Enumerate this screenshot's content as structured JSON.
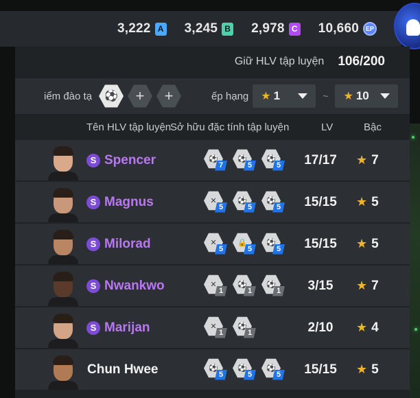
{
  "currency": [
    {
      "value": "3,222",
      "badge": "A",
      "color": "#4aa8ff"
    },
    {
      "value": "3,245",
      "badge": "B",
      "color": "#4fd0a8"
    },
    {
      "value": "2,978",
      "badge": "C",
      "color": "#b24cf0"
    },
    {
      "value": "10,660",
      "badge": "EP",
      "color": "#5b86ff"
    }
  ],
  "hold": {
    "label": "Giữ HLV tập luyện",
    "value": "106/200"
  },
  "filter": {
    "points_label": "iểm đào tạ",
    "rank_label": "ếp hạng",
    "rank_from": "1",
    "rank_to": "10",
    "tilde": "~"
  },
  "headers": {
    "name": "Tên HLV tập luyện",
    "traits": "Sở hữu đặc tính tập luyện",
    "lv": "LV",
    "rank": "Bậc"
  },
  "coaches": [
    {
      "name": "Spencer",
      "special": true,
      "lv": "17/17",
      "rank": "7",
      "traits": [
        {
          "level": "7",
          "color": "blue"
        },
        {
          "level": "5",
          "color": "blue"
        },
        {
          "level": "5",
          "color": "blue"
        }
      ]
    },
    {
      "name": "Magnus",
      "special": true,
      "lv": "15/15",
      "rank": "5",
      "traits": [
        {
          "level": "5",
          "color": "blue"
        },
        {
          "level": "5",
          "color": "blue"
        },
        {
          "level": "5",
          "color": "blue"
        }
      ]
    },
    {
      "name": "Milorad",
      "special": true,
      "lv": "15/15",
      "rank": "5",
      "traits": [
        {
          "level": "5",
          "color": "blue"
        },
        {
          "level": "5",
          "color": "blue"
        },
        {
          "level": "5",
          "color": "blue"
        }
      ]
    },
    {
      "name": "Nwankwo",
      "special": true,
      "lv": "3/15",
      "rank": "7",
      "traits": [
        {
          "level": "1",
          "color": "grey"
        },
        {
          "level": "1",
          "color": "grey"
        },
        {
          "level": "1",
          "color": "grey"
        }
      ]
    },
    {
      "name": "Marijan",
      "special": true,
      "lv": "2/10",
      "rank": "4",
      "traits": [
        {
          "level": "1",
          "color": "grey"
        },
        {
          "level": "1",
          "color": "grey"
        }
      ]
    },
    {
      "name": "Chun Hwee",
      "special": false,
      "lv": "15/15",
      "rank": "5",
      "traits": [
        {
          "level": "5",
          "color": "blue"
        },
        {
          "level": "5",
          "color": "blue"
        },
        {
          "level": "5",
          "color": "blue"
        }
      ]
    }
  ]
}
